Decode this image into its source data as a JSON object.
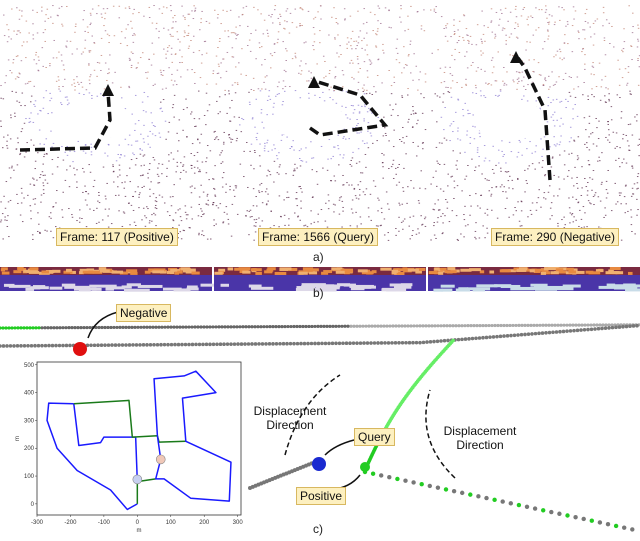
{
  "panel_a": {
    "caption": "a)",
    "frames": [
      {
        "label": "Frame: 117 (Positive)"
      },
      {
        "label": "Frame: 1566 (Query)"
      },
      {
        "label": "Frame: 290 (Negative)"
      }
    ]
  },
  "panel_b": {
    "caption": "b)"
  },
  "panel_c": {
    "caption": "c)",
    "labels": {
      "negative": "Negative",
      "query": "Query",
      "positive": "Positive"
    },
    "displacement_left": "Displacement Direction",
    "displacement_right": "Displacement Direction"
  },
  "colors": {
    "route": "#1a1aff",
    "revisit": "#1a7a1a",
    "negative": "#e01010",
    "query": "#1a2ad0",
    "positive": "#22cc22",
    "label_bg": "#fdf0c0"
  },
  "chart_data": {
    "type": "line",
    "xlabel": "m",
    "ylabel": "m",
    "xlim": [
      -300,
      310
    ],
    "ylim": [
      -40,
      510
    ],
    "xticks": [
      "-300",
      "-200",
      "-100",
      "0",
      "100",
      "200",
      "300"
    ],
    "yticks": [
      "0",
      "100",
      "200",
      "300",
      "400",
      "500"
    ],
    "series": [
      {
        "color": "#1a1aff",
        "points": [
          [
            -190,
            360
          ],
          [
            -265,
            362
          ],
          [
            -270,
            300
          ],
          [
            -240,
            200
          ],
          [
            -180,
            120
          ],
          [
            -80,
            50
          ],
          [
            -30,
            -20
          ],
          [
            0,
            0
          ]
        ]
      },
      {
        "color": "#1a7a1a",
        "points": [
          [
            0,
            0
          ],
          [
            0,
            80
          ],
          [
            55,
            90
          ]
        ]
      },
      {
        "color": "#1a1aff",
        "points": [
          [
            0,
            80
          ],
          [
            -5,
            240
          ],
          [
            -100,
            240
          ],
          [
            -110,
            220
          ],
          [
            -175,
            210
          ],
          [
            -190,
            360
          ]
        ]
      },
      {
        "color": "#1a7a1a",
        "points": [
          [
            -190,
            360
          ],
          [
            -25,
            372
          ],
          [
            -15,
            240
          ],
          [
            60,
            245
          ],
          [
            65,
            222
          ],
          [
            145,
            225
          ]
        ]
      },
      {
        "color": "#1a1aff",
        "points": [
          [
            60,
            245
          ],
          [
            50,
            450
          ],
          [
            140,
            460
          ],
          [
            175,
            477
          ],
          [
            235,
            400
          ],
          [
            135,
            380
          ],
          [
            145,
            225
          ],
          [
            280,
            150
          ],
          [
            275,
            10
          ],
          [
            160,
            20
          ],
          [
            80,
            90
          ],
          [
            55,
            90
          ],
          [
            70,
            160
          ],
          [
            60,
            245
          ]
        ]
      }
    ],
    "markers": [
      {
        "x": 0,
        "y": 88,
        "color": "#c8d0f0"
      },
      {
        "x": 70,
        "y": 160,
        "color": "#f0c8b8"
      }
    ]
  }
}
